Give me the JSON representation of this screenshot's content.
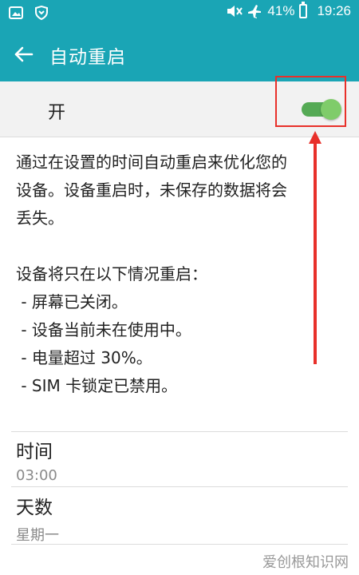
{
  "status_bar": {
    "left_icons": [
      "image-icon",
      "shield-icon"
    ],
    "right_icons": [
      "mute-icon",
      "airplane-icon",
      "battery-icon"
    ],
    "battery_text": "41%",
    "time": "19:26"
  },
  "app_bar": {
    "title": "自动重启",
    "back_icon": "back-arrow-icon"
  },
  "toggle_row": {
    "label": "开",
    "enabled": true,
    "accent_color": "#55aa55"
  },
  "description": {
    "paragraph1_line1": "通过在设置的时间自动重启来优化您的",
    "paragraph1_line2": "设备。设备重启时，未保存的数据将会",
    "paragraph1_line3": "丢失。",
    "paragraph2_title": "设备将只在以下情况重启：",
    "conditions": [
      " - 屏幕已关闭。",
      " - 设备当前未在使用中。",
      " - 电量超过 30%。",
      " - SIM 卡锁定已禁用。"
    ]
  },
  "settings": {
    "time": {
      "label": "时间",
      "value": "03:00"
    },
    "days": {
      "label": "天数",
      "value": "星期一"
    }
  },
  "watermark": "爱创根知识网",
  "colors": {
    "header": "#1aa5b5",
    "annotation": "#e8302a"
  }
}
